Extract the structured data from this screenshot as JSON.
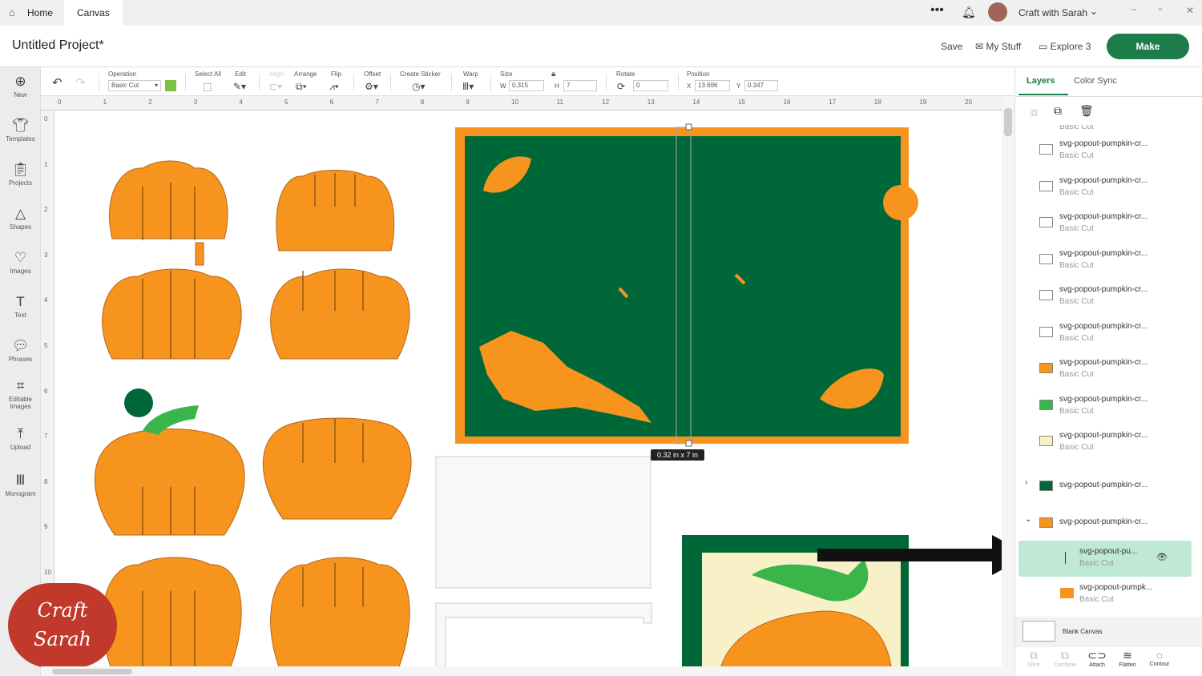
{
  "topbar": {
    "tabs": [
      "Home",
      "Canvas"
    ],
    "user": "Craft with Sarah"
  },
  "header": {
    "title": "Untitled Project*",
    "save": "Save",
    "my_stuff": "My Stuff",
    "machine": "Explore 3",
    "make": "Make"
  },
  "sidebar": [
    "New",
    "Templates",
    "Projects",
    "Shapes",
    "Images",
    "Text",
    "Phrases",
    "Editable Images",
    "Upload",
    "Monogram"
  ],
  "toolbar": {
    "operation_label": "Operation",
    "operation_value": "Basic Cut",
    "operation_color": "#7cc242",
    "select_all": "Select All",
    "edit": "Edit",
    "align": "Align",
    "arrange": "Arrange",
    "flip": "Flip",
    "offset": "Offset",
    "create_sticker": "Create Sticker",
    "warp": "Warp",
    "size": "Size",
    "w_label": "W",
    "w": "0.315",
    "h_label": "H",
    "h": "7",
    "rotate": "Rotate",
    "rotate_value": "0",
    "position": "Position",
    "x_label": "X",
    "x": "13.696",
    "y_label": "Y",
    "y": "0.347"
  },
  "ruler": {
    "h": [
      "0",
      "1",
      "2",
      "3",
      "4",
      "5",
      "6",
      "7",
      "8",
      "9",
      "10",
      "11",
      "12",
      "13",
      "14",
      "15",
      "16",
      "17",
      "18",
      "19",
      "20"
    ],
    "v": [
      "0",
      "1",
      "2",
      "3",
      "4",
      "5",
      "6",
      "7",
      "8",
      "9",
      "10"
    ]
  },
  "canvas": {
    "size_tooltip": "0.32  in x 7  in",
    "colors": {
      "orange": "#f7941d",
      "green": "#006838",
      "light_green": "#39b54a",
      "cream": "#f8f0c6"
    }
  },
  "logo": {
    "text": "Craft with Sarah"
  },
  "panel": {
    "tabs": [
      "Layers",
      "Color Sync"
    ],
    "layers": [
      {
        "name": "svg-popout-pumpkin-cr...",
        "op": "Basic Cut"
      },
      {
        "name": "svg-popout-pumpkin-cr...",
        "op": "Basic Cut"
      },
      {
        "name": "svg-popout-pumpkin-cr...",
        "op": "Basic Cut"
      },
      {
        "name": "svg-popout-pumpkin-cr...",
        "op": "Basic Cut"
      },
      {
        "name": "svg-popout-pumpkin-cr...",
        "op": "Basic Cut"
      },
      {
        "name": "svg-popout-pumpkin-cr...",
        "op": "Basic Cut"
      },
      {
        "name": "svg-popout-pumpkin-cr...",
        "op": "Basic Cut"
      },
      {
        "name": "svg-popout-pumpkin-cr...",
        "op": "Basic Cut"
      },
      {
        "name": "svg-popout-pumpkin-cr...",
        "op": "Basic Cut"
      }
    ],
    "top_partial": "Basic Cut",
    "group1": "svg-popout-pumpkin-cr...",
    "group2": "svg-popout-pumpkin-cr...",
    "child_selected": {
      "name": "svg-popout-pu...",
      "op": "Basic Cut"
    },
    "child2": {
      "name": "svg-popout-pumpk...",
      "op": "Basic Cut"
    },
    "blank_canvas": "Blank Canvas",
    "bottom_tools": [
      "Slice",
      "Combine",
      "Attach",
      "Flatten",
      "Contour"
    ]
  }
}
